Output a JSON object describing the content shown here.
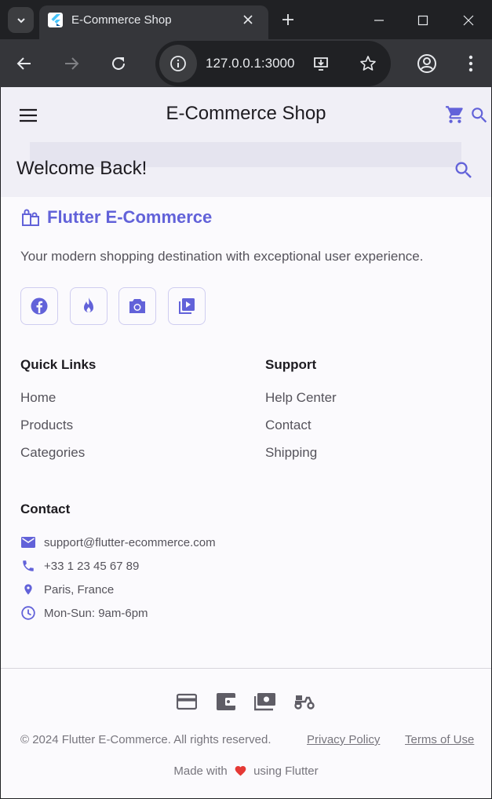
{
  "browser": {
    "tab_title": "E-Commerce Shop",
    "url": "127.0.0.1:3000"
  },
  "appbar": {
    "title": "E-Commerce Shop",
    "welcome": "Welcome Back!"
  },
  "brand": {
    "name": "Flutter E-Commerce",
    "tagline": "Your modern shopping destination with exceptional user experience."
  },
  "socials": [
    {
      "icon": "facebook-icon"
    },
    {
      "icon": "flame-icon"
    },
    {
      "icon": "camera-icon"
    },
    {
      "icon": "video-library-icon"
    }
  ],
  "quick_links": {
    "heading": "Quick Links",
    "items": [
      "Home",
      "Products",
      "Categories"
    ]
  },
  "support": {
    "heading": "Support",
    "items": [
      "Help Center",
      "Contact",
      "Shipping"
    ]
  },
  "contact": {
    "heading": "Contact",
    "items": [
      {
        "icon": "email-icon",
        "text": "support@flutter-ecommerce.com"
      },
      {
        "icon": "phone-icon",
        "text": "+33 1 23 45 67 89"
      },
      {
        "icon": "location-icon",
        "text": "Paris, France"
      },
      {
        "icon": "clock-icon",
        "text": "Mon-Sun: 9am-6pm"
      }
    ]
  },
  "payment_icons": [
    "credit-card-icon",
    "wallet-icon",
    "cash-icon",
    "delivery-scooter-icon"
  ],
  "footer": {
    "copyright": "© 2024 Flutter E-Commerce. All rights reserved.",
    "privacy": "Privacy Policy",
    "terms": "Terms of Use",
    "made_prefix": "Made with",
    "made_suffix": "using Flutter"
  },
  "colors": {
    "accent": "#6262d9",
    "appbar_bg": "#f0eff6",
    "page_bg": "#fbfafd",
    "heart": "#e53935"
  }
}
